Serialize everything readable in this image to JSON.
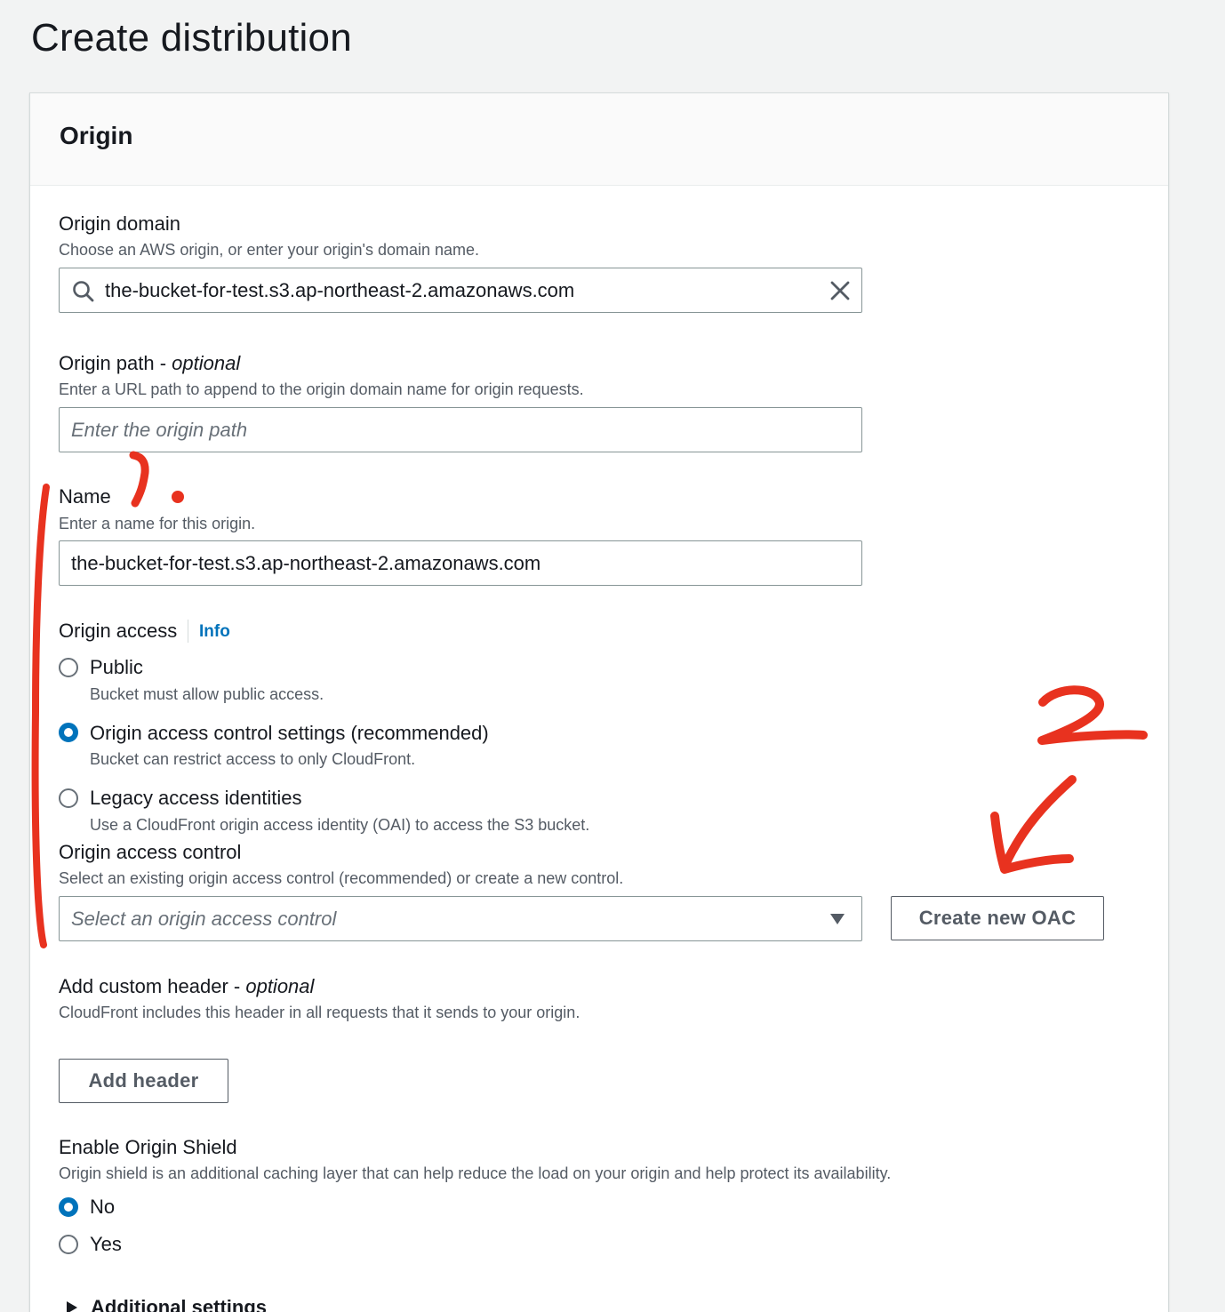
{
  "page": {
    "title": "Create distribution"
  },
  "origin_panel": {
    "title": "Origin",
    "origin_domain": {
      "label": "Origin domain",
      "description": "Choose an AWS origin, or enter your origin's domain name.",
      "value": "the-bucket-for-test.s3.ap-northeast-2.amazonaws.com"
    },
    "origin_path": {
      "label": "Origin path - ",
      "label_suffix": "optional",
      "description": "Enter a URL path to append to the origin domain name for origin requests.",
      "placeholder": "Enter the origin path"
    },
    "name": {
      "label": "Name",
      "description": "Enter a name for this origin.",
      "value": "the-bucket-for-test.s3.ap-northeast-2.amazonaws.com"
    },
    "origin_access": {
      "label": "Origin access",
      "info_link": "Info",
      "options": [
        {
          "label": "Public",
          "description": "Bucket must allow public access.",
          "checked": false
        },
        {
          "label": "Origin access control settings (recommended)",
          "description": "Bucket can restrict access to only CloudFront.",
          "checked": true
        },
        {
          "label": "Legacy access identities",
          "description": "Use a CloudFront origin access identity (OAI) to access the S3 bucket.",
          "checked": false
        }
      ]
    },
    "origin_access_control": {
      "label": "Origin access control",
      "description": "Select an existing origin access control (recommended) or create a new control.",
      "placeholder": "Select an origin access control",
      "create_button": "Create new OAC"
    },
    "custom_header": {
      "label": "Add custom header - ",
      "label_suffix": "optional",
      "description": "CloudFront includes this header in all requests that it sends to your origin.",
      "button": "Add header"
    },
    "origin_shield": {
      "label": "Enable Origin Shield",
      "description": "Origin shield is an additional caching layer that can help reduce the load on your origin and help protect its availability.",
      "options": [
        {
          "label": "No",
          "checked": true
        },
        {
          "label": "Yes",
          "checked": false
        }
      ]
    },
    "additional_settings": {
      "label": "Additional settings"
    }
  },
  "annotations": {
    "color": "#e8321f",
    "marker_1": "1.",
    "marker_2": "2"
  },
  "colors": {
    "accent": "#0073bb",
    "page_bg": "#f2f3f3",
    "annotation": "#e8321f"
  }
}
